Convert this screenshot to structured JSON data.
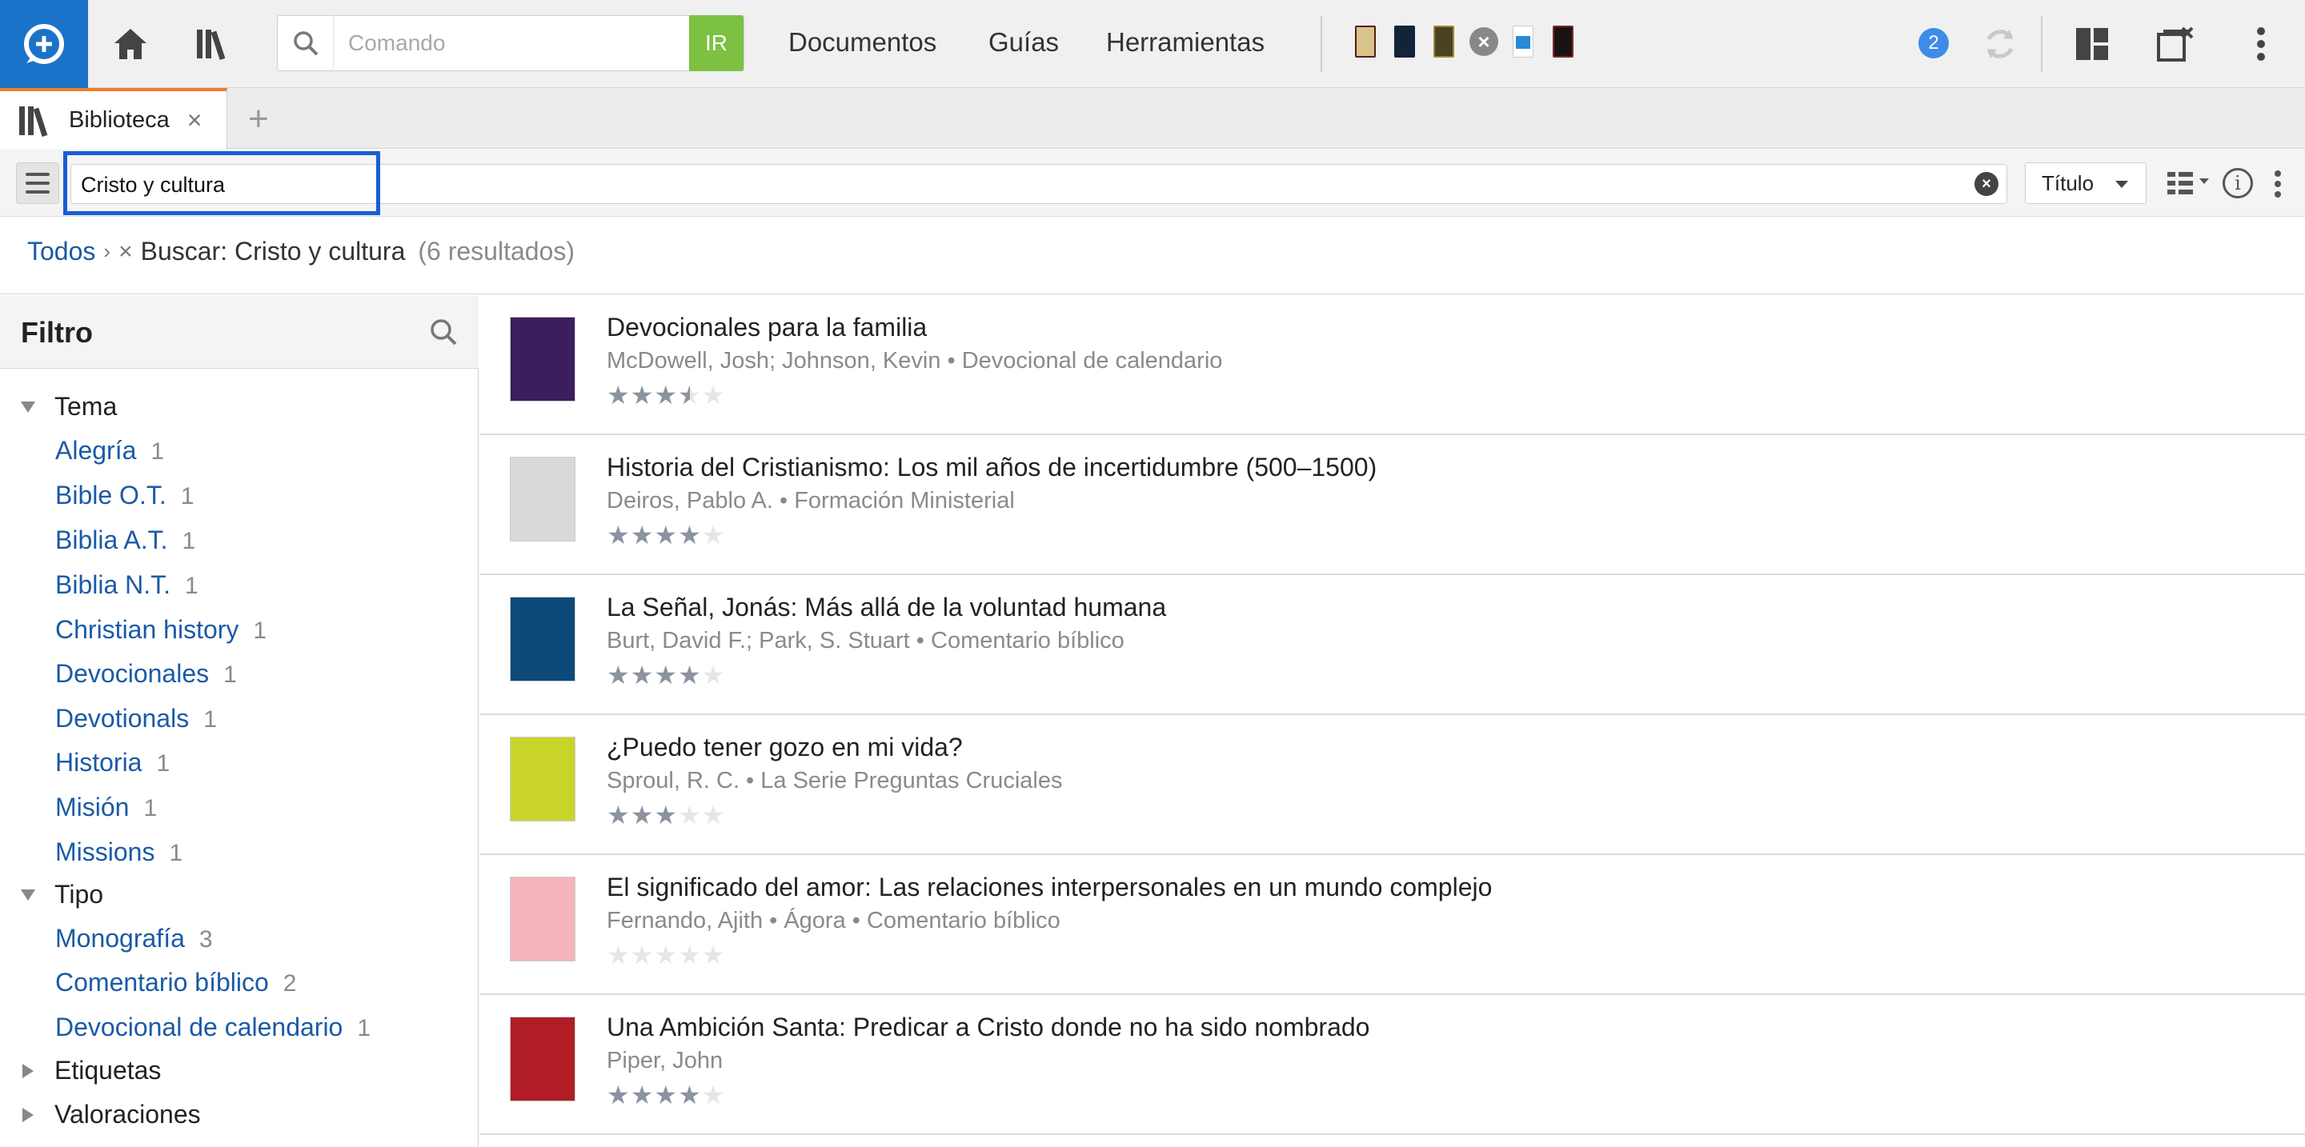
{
  "topbar": {
    "command_placeholder": "Comando",
    "go_label": "IR",
    "menu": [
      "Documentos",
      "Guías",
      "Herramientas"
    ],
    "badge_count": "2",
    "icons": [
      "logos-icon",
      "home-icon",
      "library-icon",
      "search-icon",
      "sync-icon",
      "layout-icon",
      "close-panels-icon",
      "more-vertical-icon"
    ]
  },
  "tabs": {
    "active_label": "Biblioteca",
    "close_glyph": "×",
    "add_glyph": "+"
  },
  "library": {
    "search_value": "Cristo y cultura",
    "sort_label": "Título"
  },
  "breadcrumb": {
    "root": "Todos",
    "separator": "›",
    "remove": "×",
    "query": "Buscar: Cristo y cultura",
    "count": "(6 resultados)"
  },
  "filter": {
    "title": "Filtro",
    "groups": [
      {
        "label": "Tema",
        "expanded": true
      },
      {
        "label": "Tipo",
        "expanded": true
      },
      {
        "label": "Etiquetas",
        "expanded": false
      },
      {
        "label": "Valoraciones",
        "expanded": false
      }
    ],
    "tema": [
      {
        "label": "Alegría",
        "count": "1"
      },
      {
        "label": "Bible O.T.",
        "count": "1"
      },
      {
        "label": "Biblia A.T.",
        "count": "1"
      },
      {
        "label": "Biblia N.T.",
        "count": "1"
      },
      {
        "label": "Christian history",
        "count": "1"
      },
      {
        "label": "Devocionales",
        "count": "1"
      },
      {
        "label": "Devotionals",
        "count": "1"
      },
      {
        "label": "Historia",
        "count": "1"
      },
      {
        "label": "Misión",
        "count": "1"
      },
      {
        "label": "Missions",
        "count": "1"
      }
    ],
    "tipo": [
      {
        "label": "Monografía",
        "count": "3"
      },
      {
        "label": "Comentario bíblico",
        "count": "2"
      },
      {
        "label": "Devocional de calendario",
        "count": "1"
      }
    ]
  },
  "results": [
    {
      "title": "Devocionales para la familia",
      "meta": "McDowell, Josh; Johnson, Kevin • Devocional de calendario",
      "rating": 3.5,
      "cover_color": "#3a1f5c"
    },
    {
      "title": "Historia del Cristianismo: Los mil años de incertidumbre (500–1500)",
      "meta": "Deiros, Pablo A. • Formación Ministerial",
      "rating": 4,
      "cover_color": "#d9d9d9"
    },
    {
      "title": "La Señal, Jonás: Más allá de la voluntad humana",
      "meta": "Burt, David F.; Park, S. Stuart • Comentario bíblico",
      "rating": 4,
      "cover_color": "#0d4a7a"
    },
    {
      "title": "¿Puedo tener gozo en mi vida?",
      "meta": "Sproul, R. C. • La Serie Preguntas Cruciales",
      "rating": 3,
      "cover_color": "#c9d42a"
    },
    {
      "title": "El significado del amor: Las relaciones interpersonales en un mundo complejo",
      "meta": "Fernando, Ajith • Ágora • Comentario bíblico",
      "rating": 0,
      "cover_color": "#f3b4bb"
    },
    {
      "title": "Una Ambición Santa: Predicar a Cristo donde no ha sido nombrado",
      "meta": "Piper, John",
      "rating": 4,
      "cover_color": "#b11d25"
    }
  ]
}
